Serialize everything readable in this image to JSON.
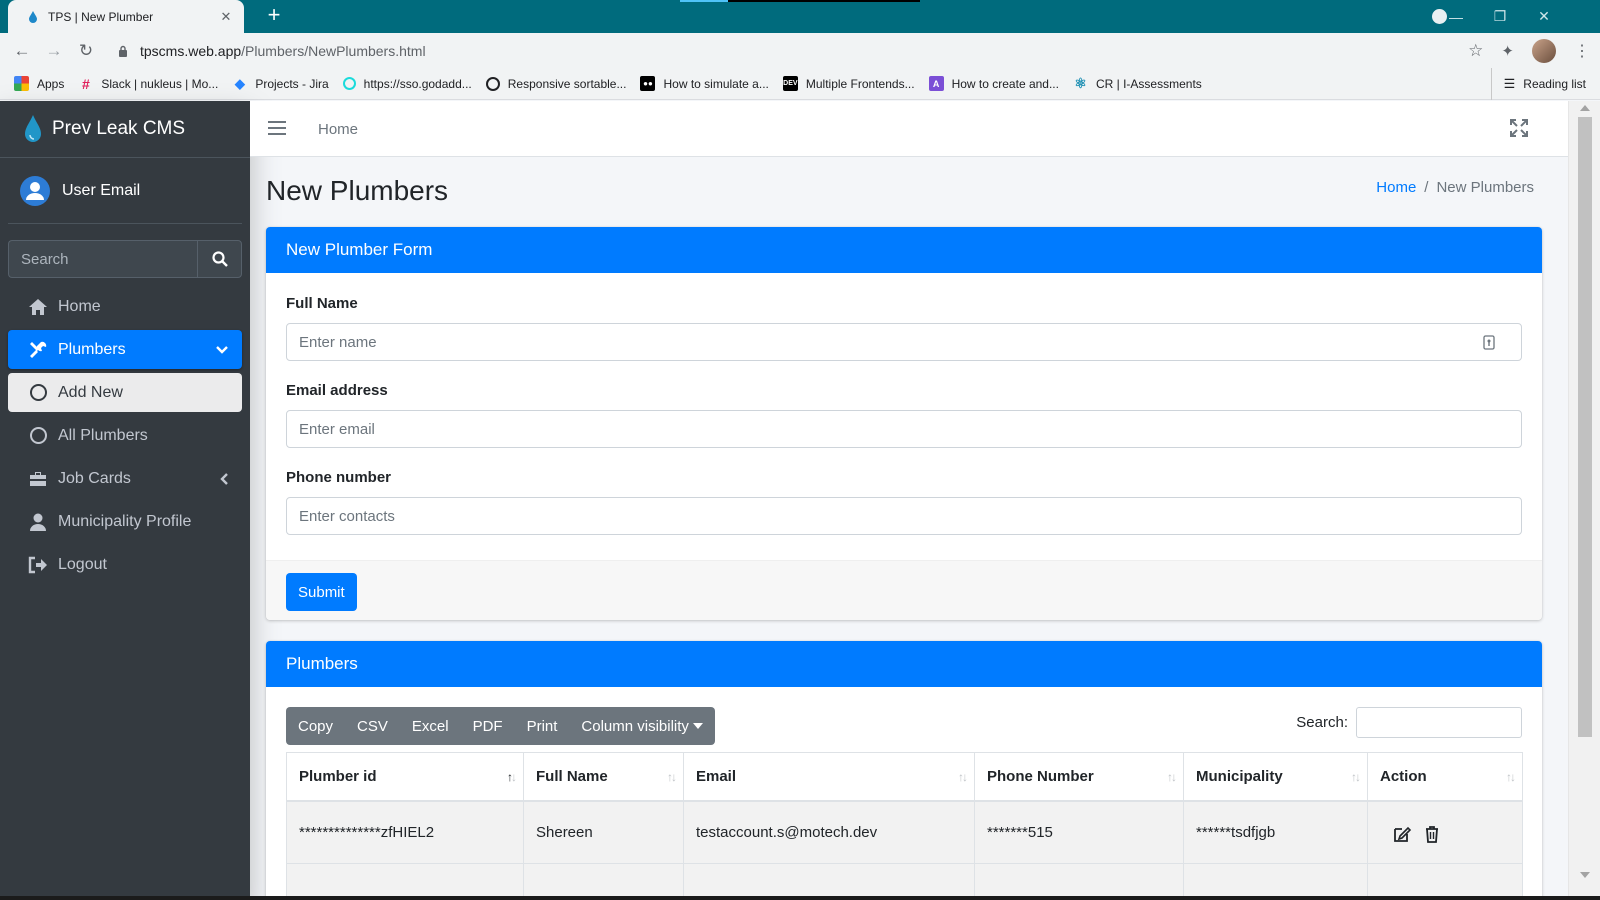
{
  "browser": {
    "tab_title": "TPS | New Plumber",
    "url_domain": "tpscms.web.app",
    "url_path": "/Plumbers/NewPlumbers.html",
    "bookmarks": [
      {
        "label": "Apps",
        "icon": "apps-grid-icon"
      },
      {
        "label": "Slack | nukleus | Mo...",
        "icon": "slack-icon"
      },
      {
        "label": "Projects - Jira",
        "icon": "jira-icon"
      },
      {
        "label": "https://sso.godadd...",
        "icon": "godaddy-icon"
      },
      {
        "label": "Responsive sortable...",
        "icon": "codepen-icon"
      },
      {
        "label": "How to simulate a...",
        "icon": "medium-icon"
      },
      {
        "label": "Multiple Frontends...",
        "icon": "dev-icon"
      },
      {
        "label": "How to create and...",
        "icon": "azure-icon"
      },
      {
        "label": "CR | I-Assessments",
        "icon": "react-icon"
      }
    ],
    "reading_list": "Reading list",
    "theme_color": "#006b7d"
  },
  "sidebar": {
    "brand": "Prev Leak CMS",
    "user": "User Email",
    "search_placeholder": "Search",
    "items": [
      {
        "label": "Home",
        "icon": "home-icon"
      },
      {
        "label": "Plumbers",
        "icon": "tools-icon"
      },
      {
        "label": "Add New",
        "icon": "circle-icon"
      },
      {
        "label": "All Plumbers",
        "icon": "circle-icon"
      },
      {
        "label": "Job Cards",
        "icon": "toolbox-icon"
      },
      {
        "label": "Municipality Profile",
        "icon": "user-icon"
      },
      {
        "label": "Logout",
        "icon": "sign-out-icon"
      }
    ]
  },
  "topnav": {
    "home": "Home"
  },
  "page": {
    "title": "New Plumbers",
    "breadcrumb": {
      "home": "Home",
      "separator": "/",
      "current": "New Plumbers"
    }
  },
  "form": {
    "header": "New Plumber Form",
    "fields": [
      {
        "label": "Full Name",
        "placeholder": "Enter name"
      },
      {
        "label": "Email address",
        "placeholder": "Enter email"
      },
      {
        "label": "Phone number",
        "placeholder": "Enter contacts"
      }
    ],
    "submit": "Submit"
  },
  "table": {
    "header": "Plumbers",
    "buttons": [
      "Copy",
      "CSV",
      "Excel",
      "PDF",
      "Print",
      "Column visibility"
    ],
    "search_label": "Search:",
    "columns": [
      "Plumber id",
      "Full Name",
      "Email",
      "Phone Number",
      "Municipality",
      "Action"
    ],
    "rows": [
      [
        "**************zfHIEL2",
        "Shereen",
        "testaccount.s@motech.dev",
        "*******515",
        "******tsdfjgb",
        ""
      ]
    ]
  },
  "colors": {
    "primary": "#007bff",
    "sidebar": "#343a40",
    "secondary": "#6c757d"
  }
}
